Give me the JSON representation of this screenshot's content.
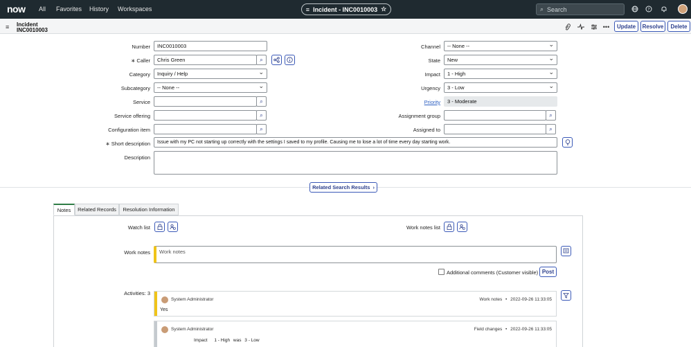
{
  "topbar": {
    "logo": "now",
    "nav": [
      "All",
      "Favorites",
      "History",
      "Workspaces"
    ],
    "center_title": "Incident - INC0010003",
    "search_placeholder": "Search"
  },
  "record": {
    "type": "Incident",
    "number": "INC0010003",
    "buttons": {
      "update": "Update",
      "resolve": "Resolve",
      "delete": "Delete"
    }
  },
  "form": {
    "number": {
      "label": "Number",
      "value": "INC0010003"
    },
    "caller": {
      "label": "Caller",
      "value": "Chris Green"
    },
    "category": {
      "label": "Category",
      "value": "Inquiry / Help"
    },
    "subcategory": {
      "label": "Subcategory",
      "value": "-- None --"
    },
    "service": {
      "label": "Service",
      "value": ""
    },
    "service_offering": {
      "label": "Service offering",
      "value": ""
    },
    "configuration_item": {
      "label": "Configuration item",
      "value": ""
    },
    "short_description": {
      "label": "Short description",
      "value": "Issue with my PC not starting up correctly with the settings I saved to my profile. Causing me to lose a lot of time every day starting work."
    },
    "description": {
      "label": "Description",
      "value": ""
    },
    "channel": {
      "label": "Channel",
      "value": "-- None --"
    },
    "state": {
      "label": "State",
      "value": "New"
    },
    "impact": {
      "label": "Impact",
      "value": "1 - High"
    },
    "urgency": {
      "label": "Urgency",
      "value": "3 - Low"
    },
    "priority": {
      "label": "Priority",
      "value": "3 - Moderate"
    },
    "assignment_group": {
      "label": "Assignment group",
      "value": ""
    },
    "assigned_to": {
      "label": "Assigned to",
      "value": ""
    }
  },
  "related_search": "Related Search Results",
  "tabs": [
    "Notes",
    "Related Records",
    "Resolution Information"
  ],
  "notes": {
    "watch_list_label": "Watch list",
    "work_notes_list_label": "Work notes list",
    "work_notes_label": "Work notes",
    "work_notes_placeholder": "Work notes",
    "additional_comments_label": "Additional comments (Customer visible)",
    "post_button": "Post",
    "activities_label": "Activities: 3"
  },
  "activities": [
    {
      "user": "System Administrator",
      "type": "Work notes",
      "timestamp": "2022-09-26 11:33:05",
      "text": "Yes"
    },
    {
      "user": "System Administrator",
      "type": "Field changes",
      "timestamp": "2022-09-26 11:33:05",
      "field": "Impact",
      "new_value": "1 - High",
      "was_word": "was",
      "old_value": "3 - Low"
    }
  ],
  "colors": {
    "topbar": "#1f2a30",
    "accent": "#3958b7",
    "work_notes_bar": "#f0c419",
    "active_tab": "#2f7d46"
  }
}
